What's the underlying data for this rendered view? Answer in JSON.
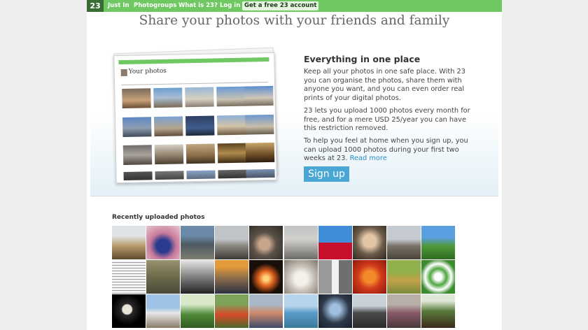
{
  "nav": {
    "logo": "23",
    "links": [
      "Just In",
      "Photogroups",
      "What is 23?",
      "Log in"
    ],
    "cta": "Get a free 23 account"
  },
  "hero": {
    "headline": "Share your photos with your friends and family",
    "heading": "Everything in one place",
    "paragraph1": "Keep all your photos in one safe place. With 23 you can organise the photos, share them with anyone you want, and you can even order real prints of your digital photos.",
    "paragraph2": "23 lets you upload 1000 photos every month for free, and for a mere USD 25/year you can have this restriction removed.",
    "paragraph3": "To help you feel at home when you sign up, you can upload 1000 photos during your first two weeks at 23.",
    "read_more": "Read more",
    "signup_label": "Sign up"
  },
  "preview": {
    "title": "Your photos"
  },
  "recent": {
    "heading": "Recently uploaded photos"
  },
  "colors": {
    "topbar": "#6fc862",
    "accent": "#4aa7d3",
    "link": "#2a8fc4"
  }
}
